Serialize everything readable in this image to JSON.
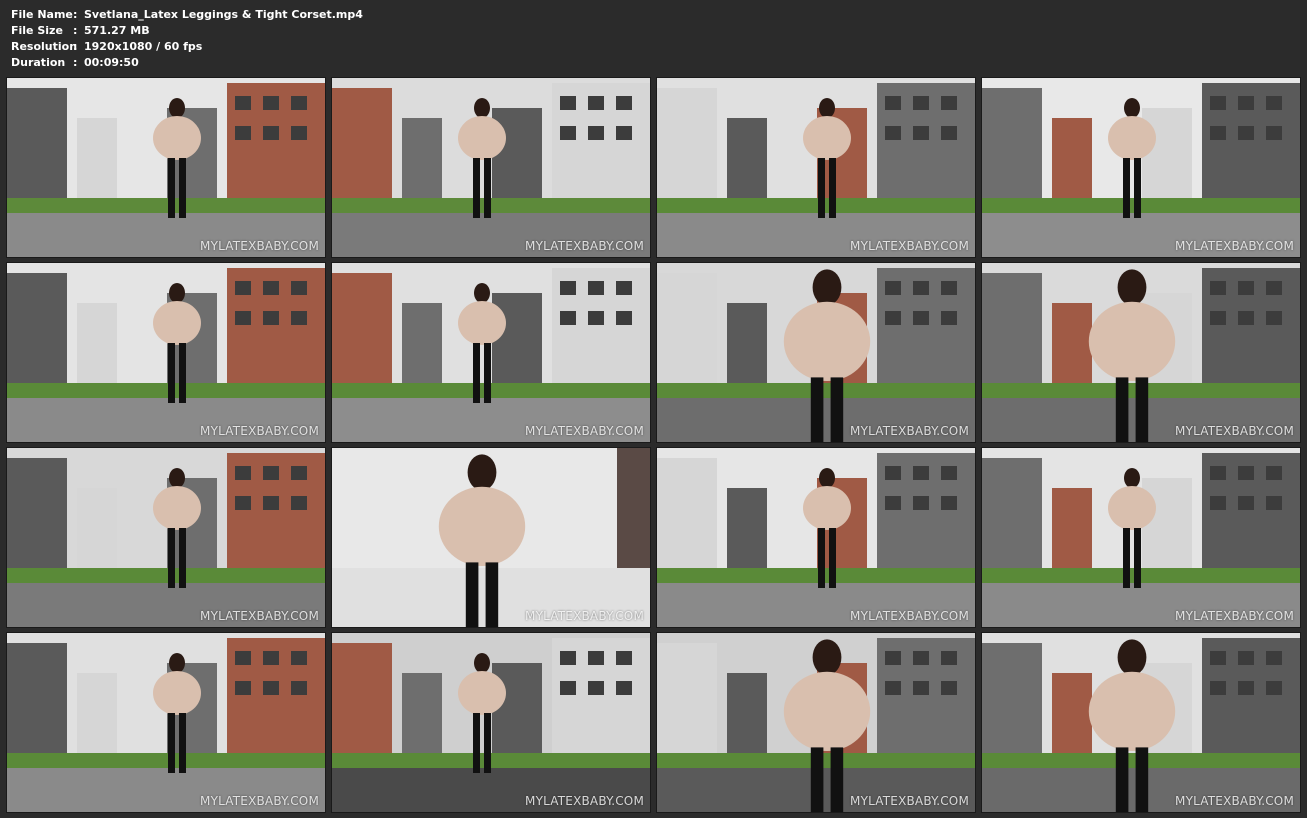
{
  "file_info": {
    "name_label": "File Name",
    "name_value": "Svetlana_Latex Leggings & Tight Corset.mp4",
    "size_label": "File Size",
    "size_value": "571.27 MB",
    "res_label": "Resolution",
    "res_value": "1920x1080 / 60 fps",
    "dur_label": "Duration",
    "dur_value": "00:09:50"
  },
  "watermark": "MYLATEXBABY.COM",
  "colors": {
    "background": "#2b2b2b",
    "text": "#ffffff"
  },
  "thumbnails": [
    {
      "scene": "street-buildings",
      "sky": "#e6e6e6",
      "ground": "#8a8a8a",
      "grass": "#5d8a3a"
    },
    {
      "scene": "brick-canopy",
      "sky": "#dcdcdc",
      "ground": "#7a7a7a",
      "grass": "#5d8a3a"
    },
    {
      "scene": "front-facade",
      "sky": "#e0e0e0",
      "ground": "#8a8a8a",
      "grass": "#5a8a38"
    },
    {
      "scene": "back-view-buildings",
      "sky": "#e8e8e8",
      "ground": "#8d8d8d",
      "grass": "#5a8a38"
    },
    {
      "scene": "gravel-walk",
      "sky": "#e4e4e4",
      "ground": "#8a8a8a",
      "grass": "#5a8a38"
    },
    {
      "scene": "back-view-path",
      "sky": "#e0e0e0",
      "ground": "#8d8d8d",
      "grass": "#5a8a38"
    },
    {
      "scene": "parking-closeup",
      "sky": "#d8d8d8",
      "ground": "#6d6d6d",
      "grass": "#5a8a38"
    },
    {
      "scene": "parking-closeup-2",
      "sky": "#dadada",
      "ground": "#6d6d6d",
      "grass": "#5a8a38"
    },
    {
      "scene": "parking-full",
      "sky": "#d8d8d8",
      "ground": "#7a7a7a",
      "grass": "#5a8a38"
    },
    {
      "scene": "white-wall-portrait",
      "sky": "#e8e8e8",
      "ground": "#e0e0e0",
      "grass": "#e0e0e0"
    },
    {
      "scene": "back-view-tower",
      "sky": "#e6e6e6",
      "ground": "#8a8a8a",
      "grass": "#5a8a38"
    },
    {
      "scene": "walk-grass",
      "sky": "#e4e4e4",
      "ground": "#8a8a8a",
      "grass": "#5a8a38"
    },
    {
      "scene": "long-street",
      "sky": "#e0e0e0",
      "ground": "#8a8a8a",
      "grass": "#5a8a38"
    },
    {
      "scene": "road-walk",
      "sky": "#cfcfcf",
      "ground": "#4a4a4a",
      "grass": "#5a8a38"
    },
    {
      "scene": "road-closeup",
      "sky": "#d0d0d0",
      "ground": "#5a5a5a",
      "grass": "#5a8a38"
    },
    {
      "scene": "stairs-boots",
      "sky": "#e0e0e0",
      "ground": "#6a6a6a",
      "grass": "#5a8a38"
    }
  ]
}
